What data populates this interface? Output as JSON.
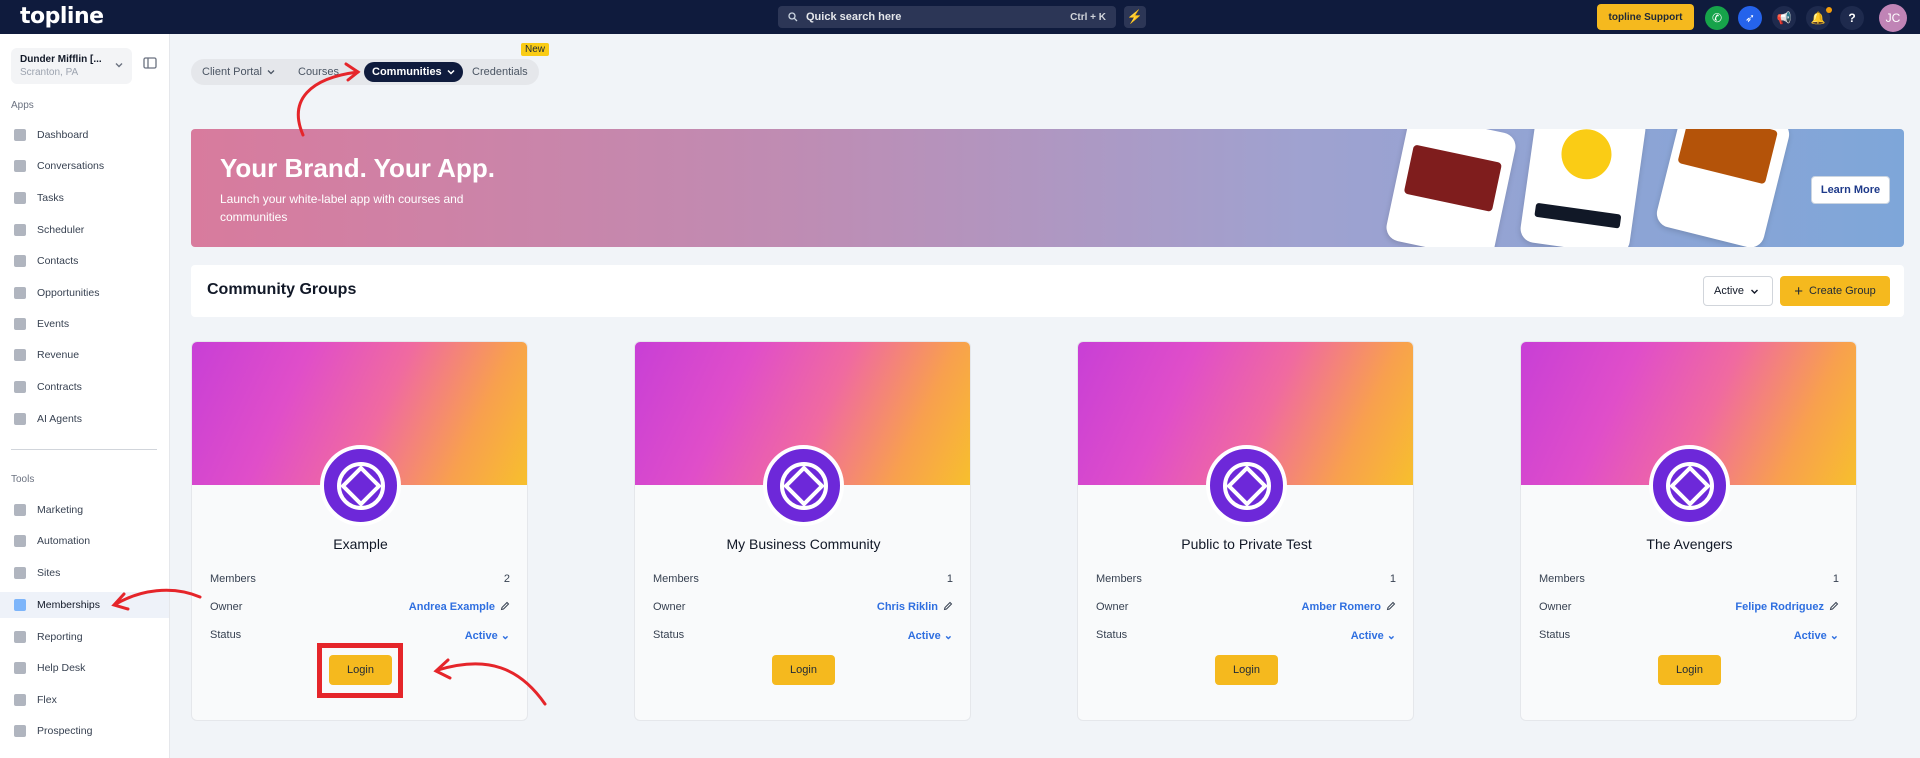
{
  "topbar": {
    "logo": "topline",
    "search_placeholder": "Quick search here",
    "search_shortcut": "Ctrl + K",
    "support_label": "topline Support",
    "avatar_initials": "JC"
  },
  "sidebar": {
    "account_name": "Dunder Mifflin [...",
    "account_location": "Scranton, PA",
    "apps_label": "Apps",
    "apps": [
      {
        "label": "Dashboard"
      },
      {
        "label": "Conversations"
      },
      {
        "label": "Tasks"
      },
      {
        "label": "Scheduler"
      },
      {
        "label": "Contacts"
      },
      {
        "label": "Opportunities"
      },
      {
        "label": "Events"
      },
      {
        "label": "Revenue"
      },
      {
        "label": "Contracts"
      },
      {
        "label": "AI Agents"
      }
    ],
    "tools_label": "Tools",
    "tools": [
      {
        "label": "Marketing"
      },
      {
        "label": "Automation"
      },
      {
        "label": "Sites"
      },
      {
        "label": "Memberships"
      },
      {
        "label": "Reporting"
      },
      {
        "label": "Help Desk"
      },
      {
        "label": "Flex"
      },
      {
        "label": "Prospecting"
      }
    ]
  },
  "tabs": [
    {
      "label": "Client Portal"
    },
    {
      "label": "Courses"
    },
    {
      "label": "Communities"
    },
    {
      "label": "Credentials"
    }
  ],
  "new_badge": "New",
  "banner": {
    "title": "Your Brand. Your App.",
    "subtitle": "Launch your white-label app with courses and communities",
    "cta": "Learn More"
  },
  "community_groups": {
    "title": "Community Groups",
    "filter_value": "Active",
    "create_label": "Create Group",
    "members_label": "Members",
    "owner_label": "Owner",
    "status_label": "Status",
    "login_label": "Login",
    "cards": [
      {
        "name": "Example",
        "members": "2",
        "owner": "Andrea Example",
        "status": "Active"
      },
      {
        "name": "My Business Community",
        "members": "1",
        "owner": "Chris Riklin",
        "status": "Active"
      },
      {
        "name": "Public to Private Test",
        "members": "1",
        "owner": "Amber Romero",
        "status": "Active"
      },
      {
        "name": "The Avengers",
        "members": "1",
        "owner": "Felipe Rodriguez",
        "status": "Active"
      }
    ]
  },
  "colors": {
    "topbar": "#0f1b3d",
    "accent": "#f5b91e",
    "link": "#2f6fe0",
    "annotation": "#e5252a"
  }
}
